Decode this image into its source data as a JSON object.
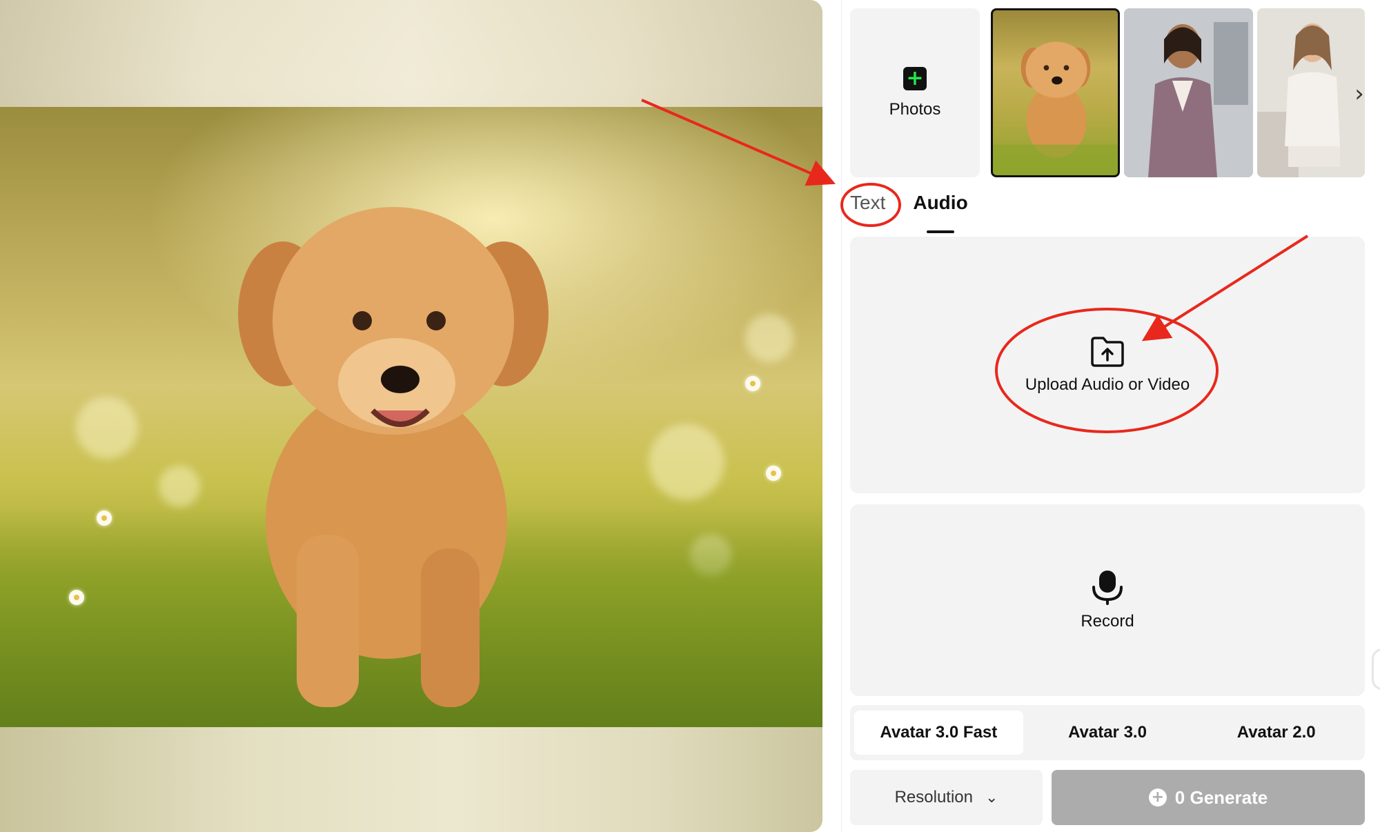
{
  "panel": {
    "photos_label": "Photos",
    "avatars": [
      "puppy",
      "woman-office",
      "woman-pajamas"
    ],
    "tabs": {
      "text": "Text",
      "audio": "Audio",
      "active": "Audio"
    },
    "upload": {
      "label": "Upload Audio or Video",
      "icon": "folder-upload-icon"
    },
    "record": {
      "label": "Record",
      "icon": "microphone-icon"
    },
    "models": [
      "Avatar 3.0 Fast",
      "Avatar 3.0",
      "Avatar 2.0"
    ],
    "active_model": "Avatar 3.0 Fast",
    "resolution_label": "Resolution",
    "generate_label": "0 Generate"
  },
  "colors": {
    "annotation_red": "#e8281c",
    "plus_green": "#25e34a",
    "generate_disabled": "#acacac",
    "tile_bg": "#f3f3f3"
  }
}
